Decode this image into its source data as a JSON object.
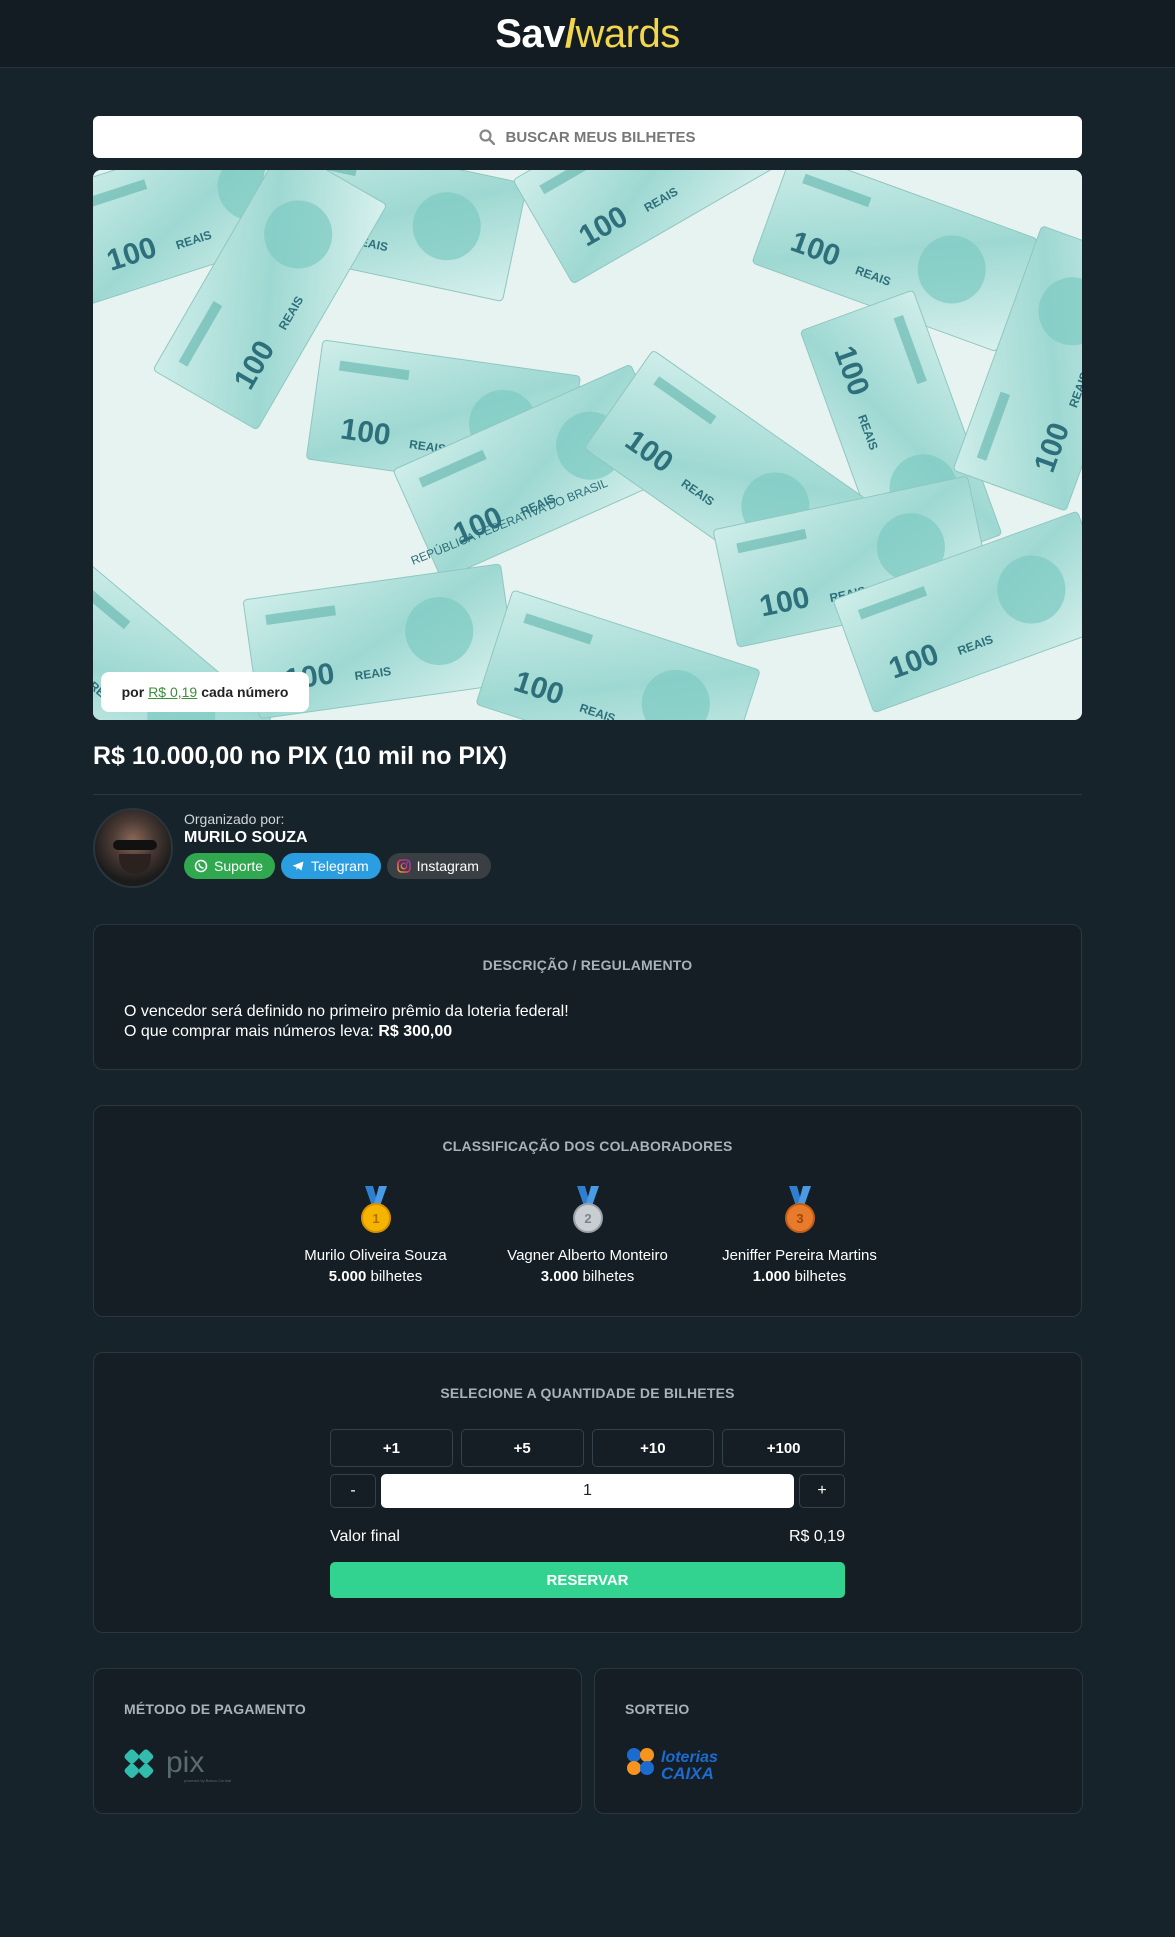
{
  "header": {
    "logo_part1": "Sav",
    "logo_slash": "/",
    "logo_part2": "wards",
    "logo_label": "Sav Awards"
  },
  "search": {
    "label": "BUSCAR MEUS BILHETES",
    "icon": "search-icon"
  },
  "banner": {
    "price_prefix": "por",
    "price": "R$ 0,19",
    "price_suffix": "cada número",
    "image_label": "100 REAIS",
    "image_text": "REPÚBLICA FEDERATIVA DO BRASIL"
  },
  "raffle": {
    "title": "R$ 10.000,00 no PIX (10 mil no PIX)"
  },
  "organizer": {
    "label": "Organizado por:",
    "name": "MURILO SOUZA",
    "socials": [
      {
        "label": "Suporte",
        "icon": "whatsapp-icon",
        "color": "#2fa84f"
      },
      {
        "label": "Telegram",
        "icon": "telegram-icon",
        "color": "#2a9ee0"
      },
      {
        "label": "Instagram",
        "icon": "instagram-icon",
        "color": "#3a3f44"
      }
    ]
  },
  "description": {
    "title": "DESCRIÇÃO / REGULAMENTO",
    "line1": "O vencedor será definido no primeiro prêmio da loteria federal!",
    "line2_prefix": "O que comprar mais números leva:",
    "line2_value": "R$ 300,00"
  },
  "ranking": {
    "title": "CLASSIFICAÇÃO DOS COLABORADORES",
    "unit": "bilhetes",
    "entries": [
      {
        "place": "1",
        "name": "Murilo Oliveira Souza",
        "count": "5.000",
        "medal_color": "#f5b400"
      },
      {
        "place": "2",
        "name": "Vagner Alberto Monteiro",
        "count": "3.000",
        "medal_color": "#b8bec4"
      },
      {
        "place": "3",
        "name": "Jeniffer Pereira Martins",
        "count": "1.000",
        "medal_color": "#e87b2b"
      }
    ]
  },
  "quantity": {
    "title": "SELECIONE A QUANTIDADE DE BILHETES",
    "quick_buttons": [
      "+1",
      "+5",
      "+10",
      "+100"
    ],
    "minus_label": "-",
    "plus_label": "+",
    "value": "1",
    "total_label": "Valor final",
    "total_value": "R$ 0,19",
    "reserve_label": "RESERVAR",
    "accent": "#32d391"
  },
  "payment": {
    "title": "MÉTODO DE PAGAMENTO",
    "method": "pix",
    "method_sub": "powered by Banco Central"
  },
  "draw": {
    "title": "SORTEIO",
    "provider_line1": "loterias",
    "provider_line2": "CAIXA"
  }
}
